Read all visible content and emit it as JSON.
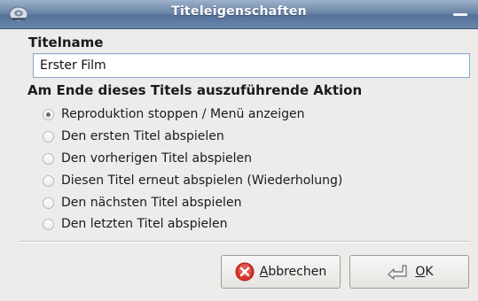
{
  "window": {
    "title": "Titeleigenschaften"
  },
  "form": {
    "name_label": "Titelname",
    "name_value": "Erster Film",
    "action_label": "Am Ende dieses Titels auszuführende Aktion",
    "options": [
      {
        "label": "Reproduktion stoppen / Menü anzeigen",
        "checked": true
      },
      {
        "label": "Den ersten Titel abspielen",
        "checked": false
      },
      {
        "label": "Den vorherigen Titel abspielen",
        "checked": false
      },
      {
        "label": "Diesen Titel erneut abspielen (Wiederholung)",
        "checked": false
      },
      {
        "label": "Den nächsten Titel abspielen",
        "checked": false
      },
      {
        "label": "Den letzten Titel abspielen",
        "checked": false
      }
    ]
  },
  "buttons": {
    "cancel_mnemonic": "A",
    "cancel_rest": "bbrechen",
    "ok_mnemonic": "O",
    "ok_rest": "K"
  },
  "icons": {
    "title": "dvd-app-icon",
    "minimize": "minimize-icon",
    "cancel": "cancel-icon",
    "ok": "ok-arrow-icon"
  },
  "colors": {
    "titlebar": "#6b85a6",
    "cancel_icon": "#d9342b",
    "input_border": "#8aa7c9"
  }
}
